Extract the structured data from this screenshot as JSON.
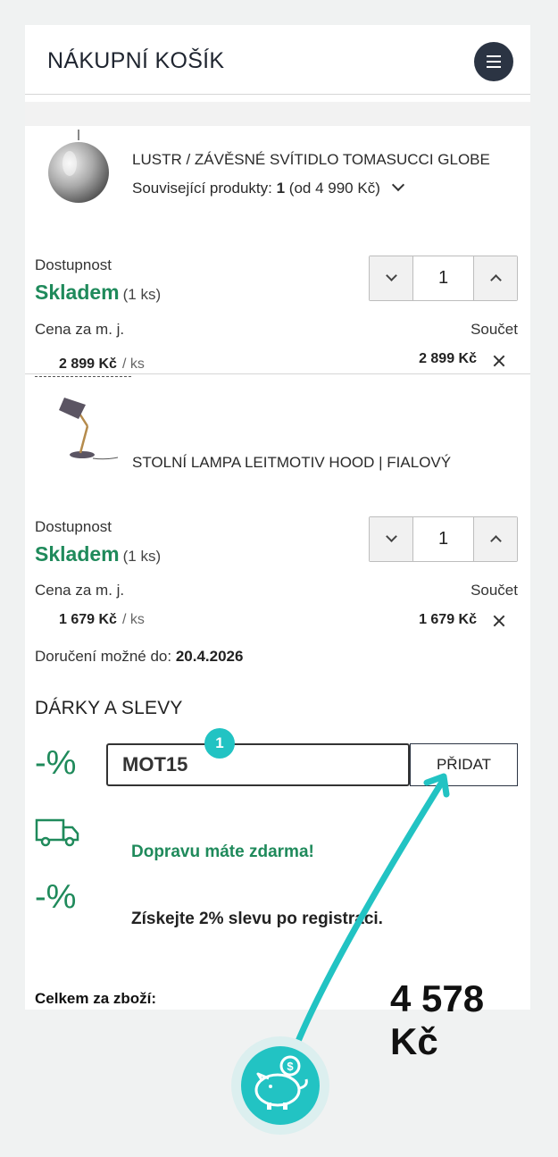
{
  "header": {
    "title": "NÁKUPNÍ KOŠÍK"
  },
  "items": [
    {
      "name": "LUSTR / ZÁVĚSNÉ SVÍTIDLO TOMASUCCI GLOBE",
      "related_label": "Související produkty:",
      "related_count": "1",
      "related_price": "(od 4 990 Kč)",
      "availability_label": "Dostupnost",
      "stock_status": "Skladem",
      "stock_count": "(1 ks)",
      "quantity": "1",
      "unit_price_label": "Cena za m. j.",
      "unit_price": "2 899 Kč",
      "per_unit": "/ ks",
      "total_label": "Součet",
      "total": "2 899 Kč"
    },
    {
      "name": "STOLNÍ LAMPA LEITMOTIV HOOD | FIALOVÝ",
      "availability_label": "Dostupnost",
      "stock_status": "Skladem",
      "stock_count": "(1 ks)",
      "quantity": "1",
      "unit_price_label": "Cena za m. j.",
      "unit_price": "1 679 Kč",
      "per_unit": "/ ks",
      "total_label": "Součet",
      "total": "1 679 Kč"
    }
  ],
  "delivery": {
    "label": "Doručení možné do:",
    "date": "20.4.2026"
  },
  "gifts": {
    "title": "DÁRKY A SLEVY",
    "percent_symbol": "-%",
    "coupon_value": "MOT15",
    "add_button": "PŘIDAT",
    "step_badge": "1",
    "free_shipping": "Dopravu máte zdarma!",
    "registration_discount": "Získejte 2% slevu po registraci."
  },
  "summary": {
    "label": "Celkem za zboží:",
    "value": "4 578 Kč"
  },
  "colors": {
    "accent_green": "#1f8a5b",
    "teal": "#22c3c3",
    "dark": "#2b3443"
  }
}
